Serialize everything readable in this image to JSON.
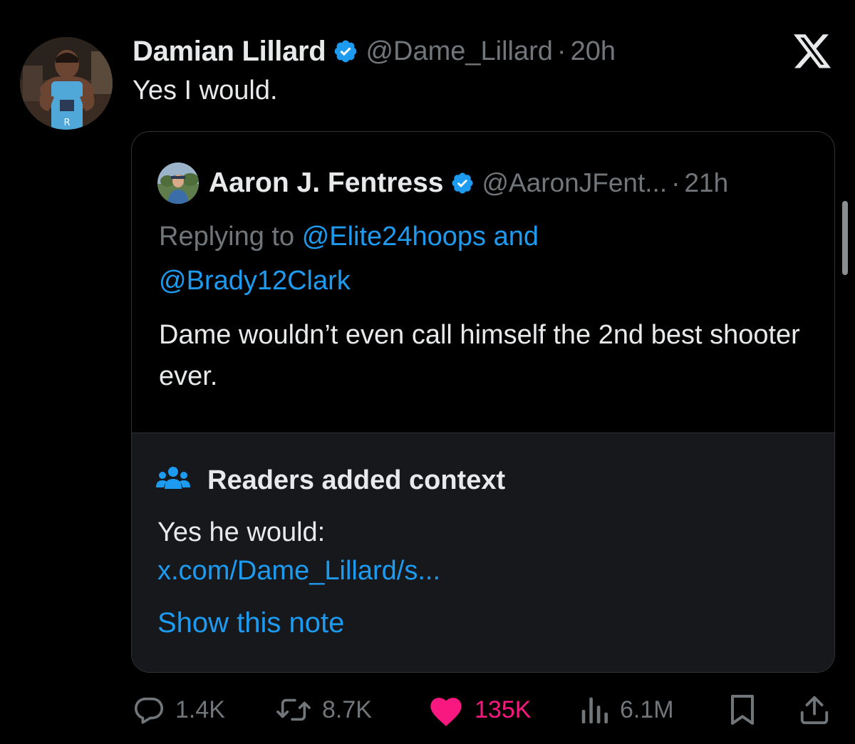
{
  "tweet": {
    "author_name": "Damian Lillard",
    "handle": "@Dame_Lillard",
    "separator": "·",
    "time": "20h",
    "text": "Yes I would.",
    "avatar_jersey_letter": "R"
  },
  "quote": {
    "author_name": "Aaron J. Fentress",
    "handle": "@AaronJFent...",
    "separator": "·",
    "time": "21h",
    "replying_prefix": "Replying to",
    "mention_1": "@Elite24hoops",
    "and_word": "and",
    "mention_2": "@Brady12Clark",
    "text": "Dame wouldn’t even call himself the 2nd best shooter ever."
  },
  "community_note": {
    "title": "Readers added context",
    "body": "Yes he would:",
    "link": "x.com/Dame_Lillard/s...",
    "show_label": "Show this note"
  },
  "actions": {
    "replies": "1.4K",
    "reposts": "8.7K",
    "likes": "135K",
    "views": "6.1M"
  },
  "colors": {
    "background": "#000000",
    "text": "#e7e9ea",
    "muted": "#71767b",
    "link": "#1d9bf0",
    "like": "#f91880",
    "note_background": "#16181c",
    "border": "#2f3336"
  },
  "icons": [
    "verified-badge-icon",
    "x-logo-icon",
    "people-icon",
    "reply-icon",
    "repost-icon",
    "heart-icon",
    "views-icon",
    "bookmark-icon",
    "share-icon"
  ]
}
